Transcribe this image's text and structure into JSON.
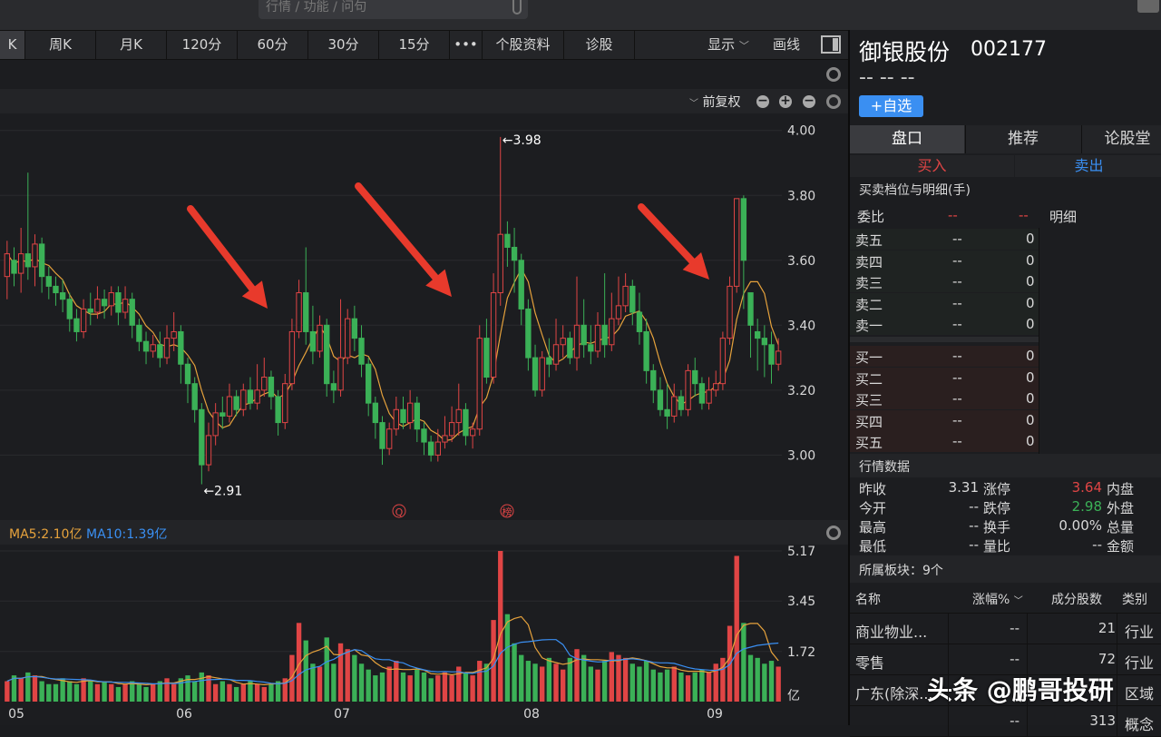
{
  "search": {
    "placeholder": "行情 / 功能 / 问句"
  },
  "tabs": [
    "K",
    "周K",
    "月K",
    "120分",
    "60分",
    "30分",
    "15分",
    "•••",
    "个股资料",
    "诊股"
  ],
  "toolbar_right": {
    "display": "显示",
    "draw": "画线"
  },
  "chart_toolbar": {
    "adjust": "前复权"
  },
  "chart_data": {
    "type": "candlestick",
    "price_axis_ticks": [
      "4.00",
      "3.80",
      "3.60",
      "3.40",
      "3.20",
      "3.00"
    ],
    "ylim": [
      2.85,
      4.03
    ],
    "high_label": "←3.98",
    "low_label": "←2.91",
    "month_labels": [
      "05",
      "06",
      "07",
      "08",
      "09"
    ],
    "markers": [
      "Q",
      "榜"
    ],
    "candles": [
      [
        3.55,
        3.62,
        3.48,
        3.66
      ],
      [
        3.6,
        3.56,
        3.52,
        3.64
      ],
      [
        3.56,
        3.62,
        3.5,
        3.7
      ],
      [
        3.62,
        3.58,
        3.54,
        3.87
      ],
      [
        3.58,
        3.65,
        3.52,
        3.68
      ],
      [
        3.65,
        3.55,
        3.5,
        3.67
      ],
      [
        3.55,
        3.52,
        3.48,
        3.58
      ],
      [
        3.52,
        3.5,
        3.46,
        3.55
      ],
      [
        3.5,
        3.48,
        3.44,
        3.54
      ],
      [
        3.48,
        3.42,
        3.38,
        3.5
      ],
      [
        3.42,
        3.38,
        3.35,
        3.45
      ],
      [
        3.38,
        3.45,
        3.36,
        3.48
      ],
      [
        3.45,
        3.44,
        3.4,
        3.5
      ],
      [
        3.44,
        3.48,
        3.42,
        3.52
      ],
      [
        3.48,
        3.46,
        3.42,
        3.51
      ],
      [
        3.46,
        3.5,
        3.43,
        3.52
      ],
      [
        3.5,
        3.44,
        3.4,
        3.52
      ],
      [
        3.44,
        3.48,
        3.42,
        3.52
      ],
      [
        3.48,
        3.4,
        3.36,
        3.5
      ],
      [
        3.4,
        3.35,
        3.32,
        3.42
      ],
      [
        3.35,
        3.32,
        3.28,
        3.38
      ],
      [
        3.32,
        3.34,
        3.3,
        3.37
      ],
      [
        3.34,
        3.3,
        3.27,
        3.38
      ],
      [
        3.3,
        3.36,
        3.28,
        3.4
      ],
      [
        3.36,
        3.38,
        3.32,
        3.44
      ],
      [
        3.38,
        3.28,
        3.22,
        3.4
      ],
      [
        3.28,
        3.22,
        3.16,
        3.3
      ],
      [
        3.22,
        3.14,
        3.1,
        3.24
      ],
      [
        3.14,
        2.97,
        2.91,
        3.16
      ],
      [
        2.97,
        3.06,
        2.95,
        3.1
      ],
      [
        3.06,
        3.13,
        3.03,
        3.16
      ],
      [
        3.13,
        3.12,
        3.08,
        3.18
      ],
      [
        3.12,
        3.18,
        3.1,
        3.22
      ],
      [
        3.18,
        3.14,
        3.12,
        3.2
      ],
      [
        3.14,
        3.2,
        3.12,
        3.22
      ],
      [
        3.2,
        3.16,
        3.14,
        3.24
      ],
      [
        3.16,
        3.2,
        3.14,
        3.28
      ],
      [
        3.2,
        3.24,
        3.18,
        3.3
      ],
      [
        3.24,
        3.18,
        3.14,
        3.26
      ],
      [
        3.18,
        3.1,
        3.06,
        3.2
      ],
      [
        3.1,
        3.22,
        3.08,
        3.25
      ],
      [
        3.22,
        3.38,
        3.2,
        3.42
      ],
      [
        3.38,
        3.5,
        3.36,
        3.54
      ],
      [
        3.5,
        3.38,
        3.34,
        3.64
      ],
      [
        3.38,
        3.32,
        3.28,
        3.46
      ],
      [
        3.32,
        3.4,
        3.3,
        3.43
      ],
      [
        3.4,
        3.22,
        3.18,
        3.42
      ],
      [
        3.22,
        3.2,
        3.16,
        3.26
      ],
      [
        3.2,
        3.3,
        3.18,
        3.48
      ],
      [
        3.3,
        3.42,
        3.28,
        3.45
      ],
      [
        3.42,
        3.36,
        3.32,
        3.46
      ],
      [
        3.36,
        3.28,
        3.24,
        3.4
      ],
      [
        3.28,
        3.16,
        3.12,
        3.3
      ],
      [
        3.16,
        3.1,
        3.05,
        3.18
      ],
      [
        3.1,
        3.02,
        2.97,
        3.12
      ],
      [
        3.02,
        3.08,
        3.0,
        3.1
      ],
      [
        3.08,
        3.14,
        3.06,
        3.18
      ],
      [
        3.14,
        3.1,
        3.08,
        3.18
      ],
      [
        3.1,
        3.16,
        3.08,
        3.2
      ],
      [
        3.16,
        3.08,
        3.04,
        3.18
      ],
      [
        3.08,
        3.04,
        3.0,
        3.1
      ],
      [
        3.04,
        3.0,
        2.98,
        3.06
      ],
      [
        3.0,
        3.04,
        2.98,
        3.08
      ],
      [
        3.04,
        3.06,
        3.02,
        3.12
      ],
      [
        3.06,
        3.1,
        3.04,
        3.15
      ],
      [
        3.1,
        3.14,
        3.06,
        3.22
      ],
      [
        3.14,
        3.06,
        3.03,
        3.16
      ],
      [
        3.06,
        3.08,
        3.02,
        3.1
      ],
      [
        3.08,
        3.36,
        3.06,
        3.4
      ],
      [
        3.36,
        3.24,
        3.22,
        3.42
      ],
      [
        3.24,
        3.5,
        3.22,
        3.56
      ],
      [
        3.5,
        3.68,
        3.46,
        3.98
      ],
      [
        3.68,
        3.64,
        3.58,
        3.72
      ],
      [
        3.64,
        3.6,
        3.5,
        3.7
      ],
      [
        3.6,
        3.45,
        3.4,
        3.62
      ],
      [
        3.45,
        3.3,
        3.26,
        3.48
      ],
      [
        3.3,
        3.2,
        3.18,
        3.34
      ],
      [
        3.2,
        3.3,
        3.18,
        3.32
      ],
      [
        3.3,
        3.28,
        3.24,
        3.36
      ],
      [
        3.28,
        3.34,
        3.26,
        3.42
      ],
      [
        3.34,
        3.36,
        3.3,
        3.4
      ],
      [
        3.36,
        3.3,
        3.28,
        3.38
      ],
      [
        3.3,
        3.4,
        3.26,
        3.55
      ],
      [
        3.4,
        3.34,
        3.3,
        3.48
      ],
      [
        3.34,
        3.32,
        3.28,
        3.4
      ],
      [
        3.32,
        3.4,
        3.3,
        3.44
      ],
      [
        3.4,
        3.34,
        3.3,
        3.56
      ],
      [
        3.34,
        3.42,
        3.32,
        3.5
      ],
      [
        3.42,
        3.46,
        3.4,
        3.55
      ],
      [
        3.46,
        3.52,
        3.44,
        3.56
      ],
      [
        3.52,
        3.44,
        3.4,
        3.54
      ],
      [
        3.44,
        3.38,
        3.34,
        3.5
      ],
      [
        3.38,
        3.26,
        3.22,
        3.42
      ],
      [
        3.26,
        3.2,
        3.16,
        3.28
      ],
      [
        3.2,
        3.14,
        3.12,
        3.24
      ],
      [
        3.14,
        3.12,
        3.08,
        3.22
      ],
      [
        3.12,
        3.18,
        3.1,
        3.22
      ],
      [
        3.18,
        3.14,
        3.12,
        3.2
      ],
      [
        3.14,
        3.26,
        3.12,
        3.28
      ],
      [
        3.26,
        3.22,
        3.18,
        3.3
      ],
      [
        3.22,
        3.16,
        3.14,
        3.24
      ],
      [
        3.16,
        3.2,
        3.14,
        3.24
      ],
      [
        3.2,
        3.22,
        3.18,
        3.26
      ],
      [
        3.22,
        3.36,
        3.2,
        3.38
      ],
      [
        3.36,
        3.52,
        3.34,
        3.55
      ],
      [
        3.52,
        3.79,
        3.5,
        3.79
      ],
      [
        3.79,
        3.6,
        3.45,
        3.8
      ],
      [
        3.5,
        3.4,
        3.3,
        3.44
      ],
      [
        3.38,
        3.36,
        3.26,
        3.42
      ],
      [
        3.36,
        3.34,
        3.24,
        3.4
      ],
      [
        3.34,
        3.28,
        3.22,
        3.38
      ],
      [
        3.28,
        3.32,
        3.26,
        3.36
      ]
    ],
    "volume_axis_ticks": [
      "5.17",
      "3.45",
      "1.72"
    ],
    "volume_unit": "亿",
    "volume_ylim": [
      0,
      5.17
    ],
    "volumes": [
      0.7,
      0.9,
      0.8,
      1.0,
      0.9,
      0.7,
      0.6,
      0.6,
      0.8,
      0.7,
      0.6,
      0.8,
      0.7,
      0.6,
      0.7,
      0.6,
      0.5,
      0.6,
      0.7,
      0.6,
      0.5,
      0.6,
      0.7,
      0.8,
      0.6,
      0.8,
      0.9,
      0.7,
      1.0,
      0.9,
      0.6,
      0.7,
      0.6,
      0.5,
      0.6,
      0.7,
      0.6,
      0.5,
      0.6,
      0.7,
      0.8,
      1.6,
      2.7,
      2.1,
      1.3,
      1.2,
      2.2,
      1.3,
      2.0,
      1.8,
      1.6,
      1.3,
      1.1,
      0.9,
      1.0,
      1.2,
      1.4,
      1.0,
      0.9,
      1.1,
      1.0,
      0.8,
      0.9,
      1.0,
      0.9,
      1.2,
      1.0,
      0.9,
      1.4,
      1.3,
      2.8,
      5.17,
      3.0,
      2.0,
      1.6,
      1.4,
      1.3,
      1.2,
      1.5,
      1.3,
      1.1,
      1.5,
      1.8,
      1.6,
      1.2,
      1.1,
      1.4,
      1.7,
      1.6,
      1.5,
      1.3,
      1.2,
      1.4,
      1.1,
      1.0,
      1.1,
      1.2,
      1.0,
      0.9,
      1.0,
      1.1,
      1.0,
      1.3,
      1.5,
      2.6,
      5.0,
      2.7,
      1.6,
      1.5,
      1.3,
      1.4,
      1.2
    ],
    "volume_legend": {
      "ma5": "MA5:2.10亿",
      "ma10": "MA10:1.39亿"
    }
  },
  "colors": {
    "up": "#e04545",
    "down": "#3bb157",
    "ma5": "#e6a23c",
    "ma10": "#3a8ff2",
    "arrow": "#e83a2c"
  },
  "stock": {
    "name": "御银股份",
    "code": "002177",
    "price": "-- -- --",
    "add_watch": "+自选"
  },
  "right_tabs": [
    "盘口",
    "推荐",
    "论股堂"
  ],
  "trade_buttons": {
    "buy": "买入",
    "sell": "卖出"
  },
  "orderbook": {
    "title": "买卖档位与明细(手)",
    "ratio_label": "委比",
    "ratio_a": "--",
    "ratio_b": "--",
    "detail_label": "明细",
    "sell": [
      [
        "卖五",
        "--",
        "0"
      ],
      [
        "卖四",
        "--",
        "0"
      ],
      [
        "卖三",
        "--",
        "0"
      ],
      [
        "卖二",
        "--",
        "0"
      ],
      [
        "卖一",
        "--",
        "0"
      ]
    ],
    "buy": [
      [
        "买一",
        "--",
        "0"
      ],
      [
        "买二",
        "--",
        "0"
      ],
      [
        "买三",
        "--",
        "0"
      ],
      [
        "买四",
        "--",
        "0"
      ],
      [
        "买五",
        "--",
        "0"
      ]
    ]
  },
  "quote": {
    "title": "行情数据",
    "rows": [
      [
        "昨收",
        "3.31",
        "涨停",
        "3.64",
        "内盘"
      ],
      [
        "今开",
        "--",
        "跌停",
        "2.98",
        "外盘"
      ],
      [
        "最高",
        "--",
        "换手",
        "0.00%",
        "总量"
      ],
      [
        "最低",
        "--",
        "量比",
        "--",
        "金额"
      ]
    ]
  },
  "sectors": {
    "title": "所属板块：9个",
    "headers": [
      "名称",
      "涨幅%",
      "成分股数",
      "类别"
    ],
    "rows": [
      [
        "商业物业...",
        "--",
        "21",
        "行业"
      ],
      [
        "零售",
        "--",
        "72",
        "行业"
      ],
      [
        "广东(除深...",
        "",
        "",
        "区域"
      ],
      [
        "",
        "--",
        "313",
        "概念"
      ]
    ]
  },
  "watermark": "头条 @鹏哥投研"
}
